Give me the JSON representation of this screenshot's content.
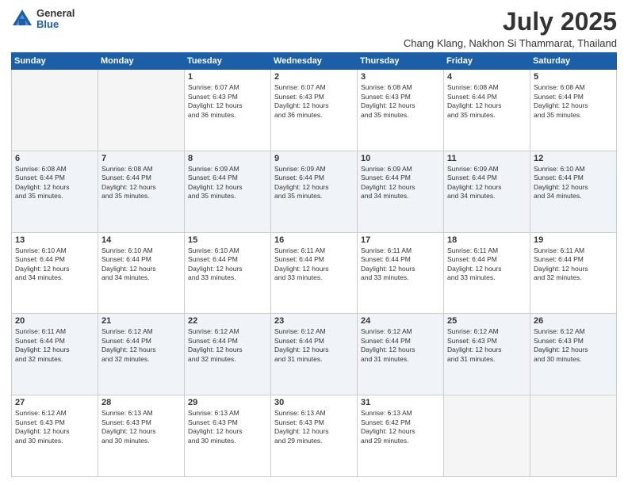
{
  "logo": {
    "general": "General",
    "blue": "Blue"
  },
  "title": "July 2025",
  "subtitle": "Chang Klang, Nakhon Si Thammarat, Thailand",
  "headers": [
    "Sunday",
    "Monday",
    "Tuesday",
    "Wednesday",
    "Thursday",
    "Friday",
    "Saturday"
  ],
  "weeks": [
    [
      {
        "day": "",
        "info": ""
      },
      {
        "day": "",
        "info": ""
      },
      {
        "day": "1",
        "info": "Sunrise: 6:07 AM\nSunset: 6:43 PM\nDaylight: 12 hours\nand 36 minutes."
      },
      {
        "day": "2",
        "info": "Sunrise: 6:07 AM\nSunset: 6:43 PM\nDaylight: 12 hours\nand 36 minutes."
      },
      {
        "day": "3",
        "info": "Sunrise: 6:08 AM\nSunset: 6:43 PM\nDaylight: 12 hours\nand 35 minutes."
      },
      {
        "day": "4",
        "info": "Sunrise: 6:08 AM\nSunset: 6:44 PM\nDaylight: 12 hours\nand 35 minutes."
      },
      {
        "day": "5",
        "info": "Sunrise: 6:08 AM\nSunset: 6:44 PM\nDaylight: 12 hours\nand 35 minutes."
      }
    ],
    [
      {
        "day": "6",
        "info": "Sunrise: 6:08 AM\nSunset: 6:44 PM\nDaylight: 12 hours\nand 35 minutes."
      },
      {
        "day": "7",
        "info": "Sunrise: 6:08 AM\nSunset: 6:44 PM\nDaylight: 12 hours\nand 35 minutes."
      },
      {
        "day": "8",
        "info": "Sunrise: 6:09 AM\nSunset: 6:44 PM\nDaylight: 12 hours\nand 35 minutes."
      },
      {
        "day": "9",
        "info": "Sunrise: 6:09 AM\nSunset: 6:44 PM\nDaylight: 12 hours\nand 35 minutes."
      },
      {
        "day": "10",
        "info": "Sunrise: 6:09 AM\nSunset: 6:44 PM\nDaylight: 12 hours\nand 34 minutes."
      },
      {
        "day": "11",
        "info": "Sunrise: 6:09 AM\nSunset: 6:44 PM\nDaylight: 12 hours\nand 34 minutes."
      },
      {
        "day": "12",
        "info": "Sunrise: 6:10 AM\nSunset: 6:44 PM\nDaylight: 12 hours\nand 34 minutes."
      }
    ],
    [
      {
        "day": "13",
        "info": "Sunrise: 6:10 AM\nSunset: 6:44 PM\nDaylight: 12 hours\nand 34 minutes."
      },
      {
        "day": "14",
        "info": "Sunrise: 6:10 AM\nSunset: 6:44 PM\nDaylight: 12 hours\nand 34 minutes."
      },
      {
        "day": "15",
        "info": "Sunrise: 6:10 AM\nSunset: 6:44 PM\nDaylight: 12 hours\nand 33 minutes."
      },
      {
        "day": "16",
        "info": "Sunrise: 6:11 AM\nSunset: 6:44 PM\nDaylight: 12 hours\nand 33 minutes."
      },
      {
        "day": "17",
        "info": "Sunrise: 6:11 AM\nSunset: 6:44 PM\nDaylight: 12 hours\nand 33 minutes."
      },
      {
        "day": "18",
        "info": "Sunrise: 6:11 AM\nSunset: 6:44 PM\nDaylight: 12 hours\nand 33 minutes."
      },
      {
        "day": "19",
        "info": "Sunrise: 6:11 AM\nSunset: 6:44 PM\nDaylight: 12 hours\nand 32 minutes."
      }
    ],
    [
      {
        "day": "20",
        "info": "Sunrise: 6:11 AM\nSunset: 6:44 PM\nDaylight: 12 hours\nand 32 minutes."
      },
      {
        "day": "21",
        "info": "Sunrise: 6:12 AM\nSunset: 6:44 PM\nDaylight: 12 hours\nand 32 minutes."
      },
      {
        "day": "22",
        "info": "Sunrise: 6:12 AM\nSunset: 6:44 PM\nDaylight: 12 hours\nand 32 minutes."
      },
      {
        "day": "23",
        "info": "Sunrise: 6:12 AM\nSunset: 6:44 PM\nDaylight: 12 hours\nand 31 minutes."
      },
      {
        "day": "24",
        "info": "Sunrise: 6:12 AM\nSunset: 6:44 PM\nDaylight: 12 hours\nand 31 minutes."
      },
      {
        "day": "25",
        "info": "Sunrise: 6:12 AM\nSunset: 6:43 PM\nDaylight: 12 hours\nand 31 minutes."
      },
      {
        "day": "26",
        "info": "Sunrise: 6:12 AM\nSunset: 6:43 PM\nDaylight: 12 hours\nand 30 minutes."
      }
    ],
    [
      {
        "day": "27",
        "info": "Sunrise: 6:12 AM\nSunset: 6:43 PM\nDaylight: 12 hours\nand 30 minutes."
      },
      {
        "day": "28",
        "info": "Sunrise: 6:13 AM\nSunset: 6:43 PM\nDaylight: 12 hours\nand 30 minutes."
      },
      {
        "day": "29",
        "info": "Sunrise: 6:13 AM\nSunset: 6:43 PM\nDaylight: 12 hours\nand 30 minutes."
      },
      {
        "day": "30",
        "info": "Sunrise: 6:13 AM\nSunset: 6:43 PM\nDaylight: 12 hours\nand 29 minutes."
      },
      {
        "day": "31",
        "info": "Sunrise: 6:13 AM\nSunset: 6:42 PM\nDaylight: 12 hours\nand 29 minutes."
      },
      {
        "day": "",
        "info": ""
      },
      {
        "day": "",
        "info": ""
      }
    ]
  ]
}
